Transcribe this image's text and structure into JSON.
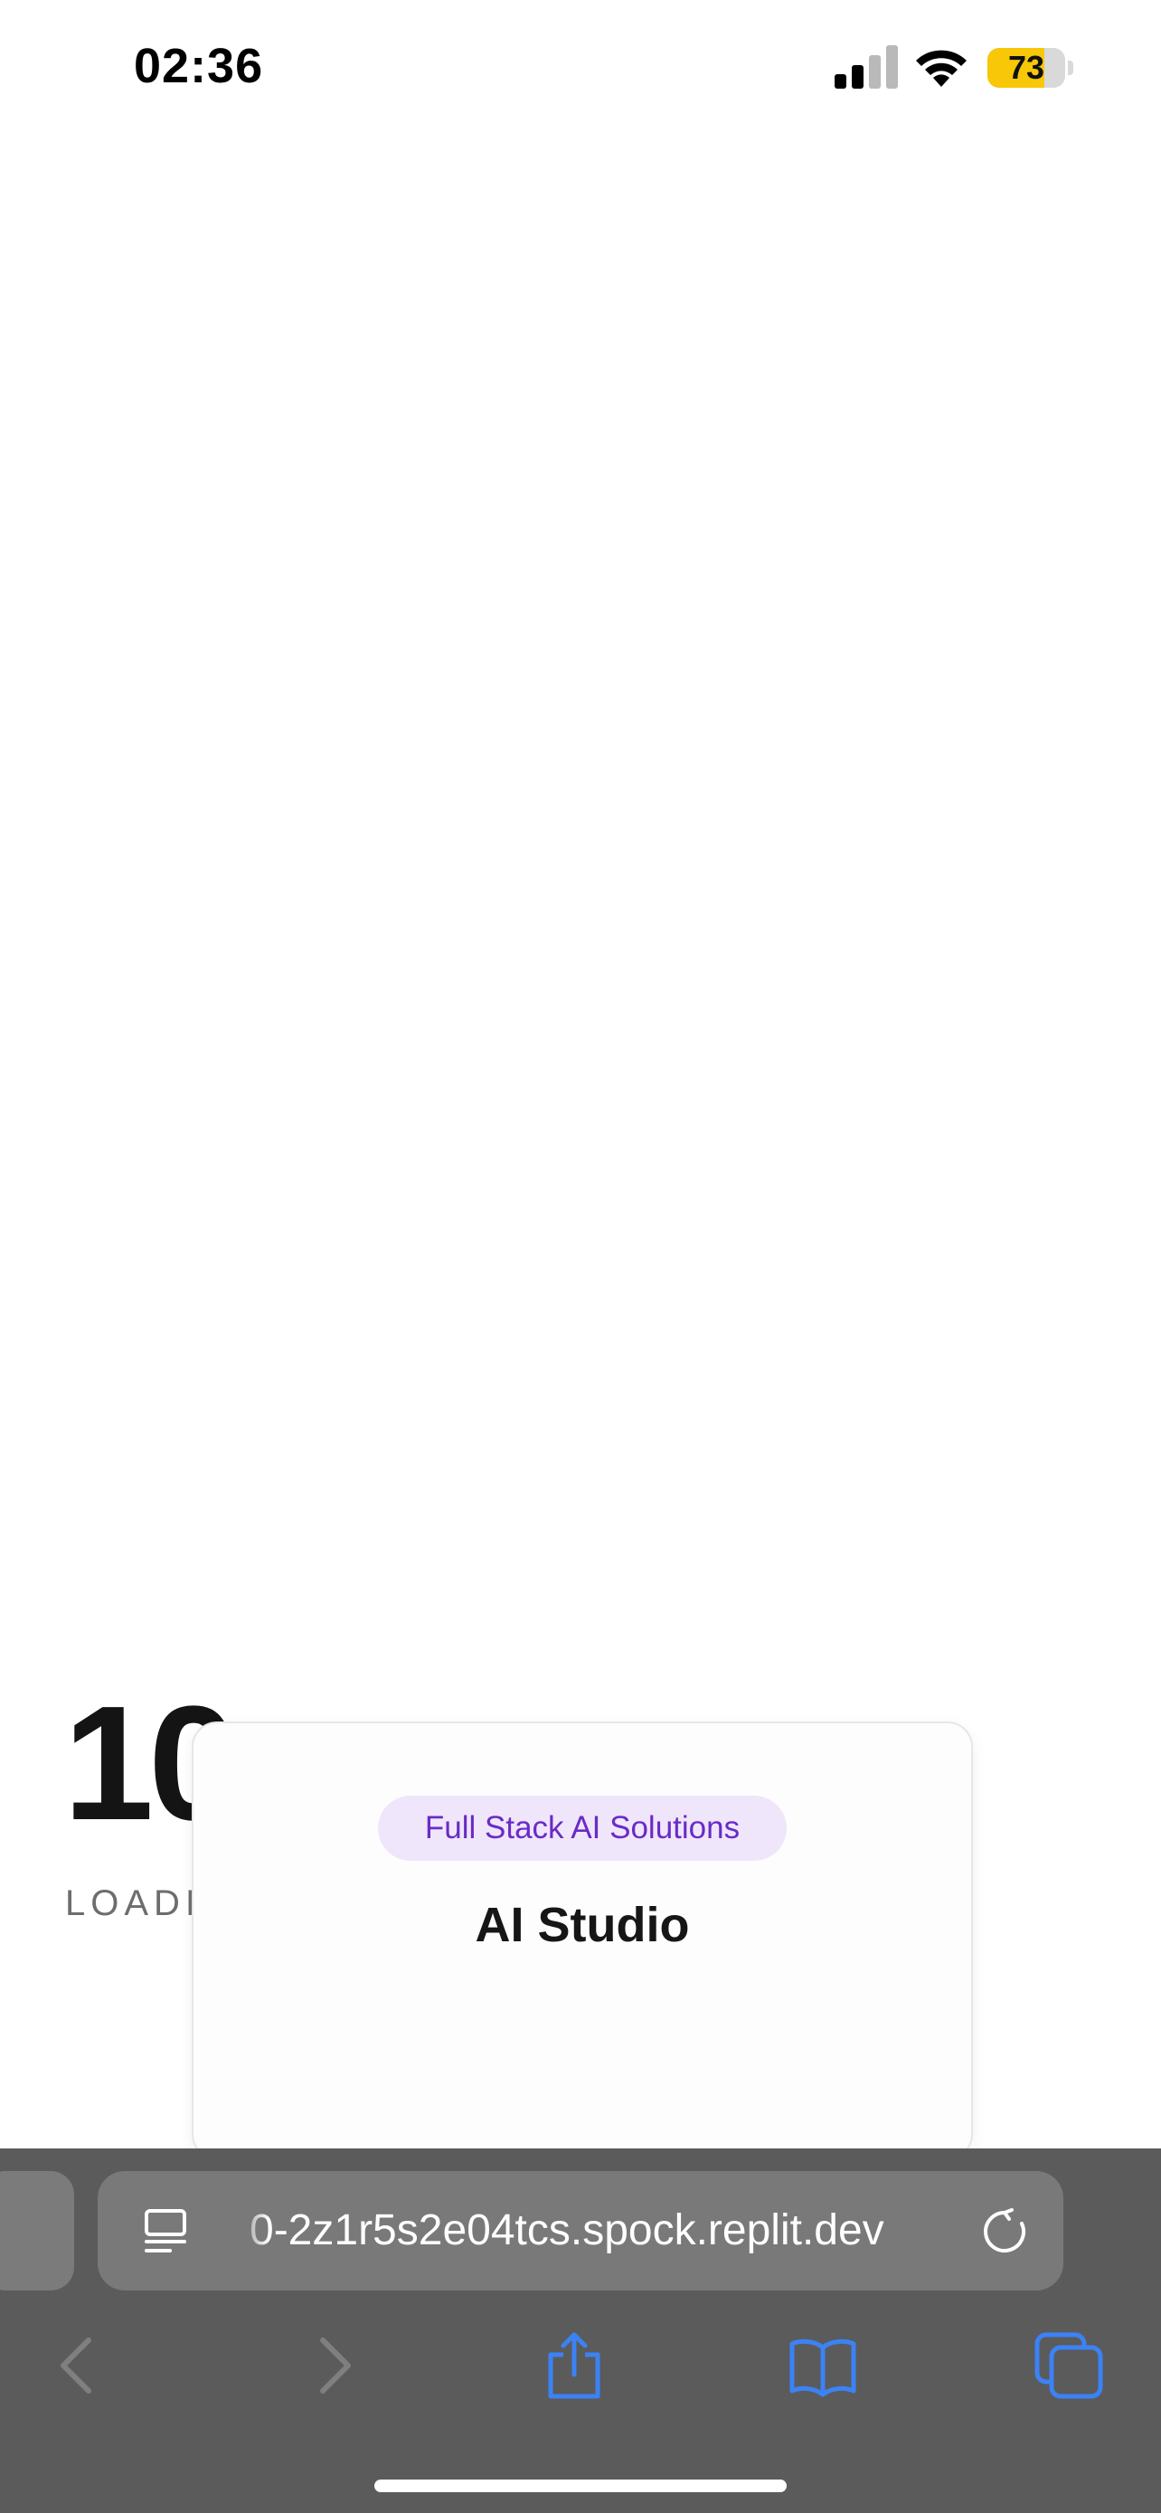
{
  "status_bar": {
    "time": "02:36",
    "battery_level": "73",
    "battery_fraction": 0.73,
    "battery_color": "#f7c708",
    "signal_icon": "cellular-signal-icon",
    "wifi_icon": "wifi-icon"
  },
  "loader": {
    "progress_value": "10",
    "label": "LOADI"
  },
  "card": {
    "badge": "Full Stack AI Solutions",
    "title": "AI Studio",
    "badge_color": "#6a2bc6"
  },
  "browser": {
    "url": "0-2z1r5s2e04tcs.spock.replit.dev",
    "icons": {
      "reader": "reader-mode-icon",
      "reload": "reload-icon",
      "back": "back-icon",
      "forward": "forward-icon",
      "share": "share-icon",
      "bookmarks": "bookmarks-icon",
      "tabs": "tabs-icon"
    },
    "accent_color": "#3b82f6"
  }
}
